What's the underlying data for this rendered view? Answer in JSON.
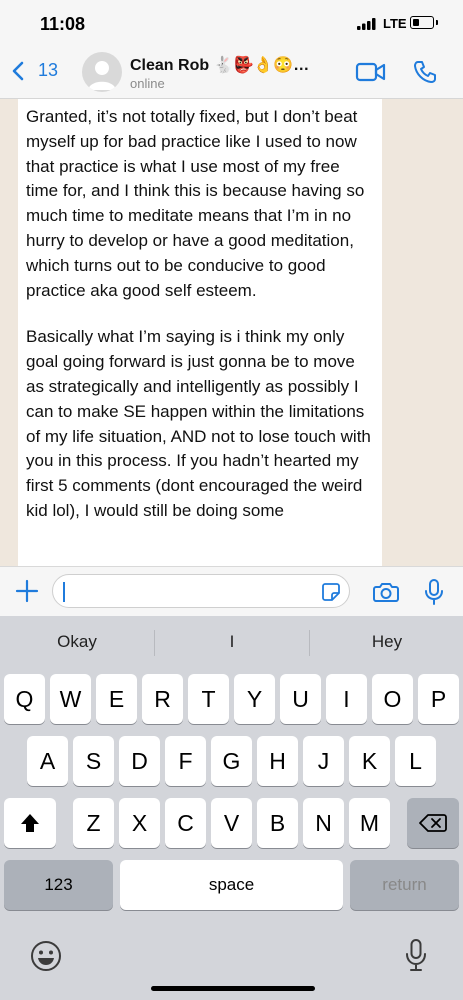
{
  "status_bar": {
    "time": "11:08",
    "network": "LTE"
  },
  "header": {
    "back_count": "13",
    "contact_name": "Clean Rob 🐇👺👌😳…",
    "contact_status": "online"
  },
  "message": {
    "paragraphs": [
      "Granted, it’s not totally fixed, but I don’t beat myself up for bad practice like I used to now that practice is what I use most of my free time for, and I think this is because having so much time to meditate means that I’m in no hurry to develop or have a good meditation, which turns out to be conducive to good practice aka good self esteem.",
      "Basically what I’m saying is i think my only goal going forward is just gonna be to move as strategically and intelligently as possibly I can to make SE happen within the limitations of my life situation, AND not to lose touch with you in this process. If you hadn’t hearted my first 5 comments (dont encouraged the weird kid lol), I would still be doing some"
    ]
  },
  "composer": {
    "placeholder": ""
  },
  "keyboard": {
    "predictions": [
      "Okay",
      "I",
      "Hey"
    ],
    "row1": [
      "Q",
      "W",
      "E",
      "R",
      "T",
      "Y",
      "U",
      "I",
      "O",
      "P"
    ],
    "row2": [
      "A",
      "S",
      "D",
      "F",
      "G",
      "H",
      "J",
      "K",
      "L"
    ],
    "row3": [
      "Z",
      "X",
      "C",
      "V",
      "B",
      "N",
      "M"
    ],
    "numbers_label": "123",
    "space_label": "space",
    "return_label": "return"
  },
  "colors": {
    "accent": "#1f7bdc",
    "chat_bg": "#efe7dd",
    "keyboard_bg": "#d3d5da"
  }
}
